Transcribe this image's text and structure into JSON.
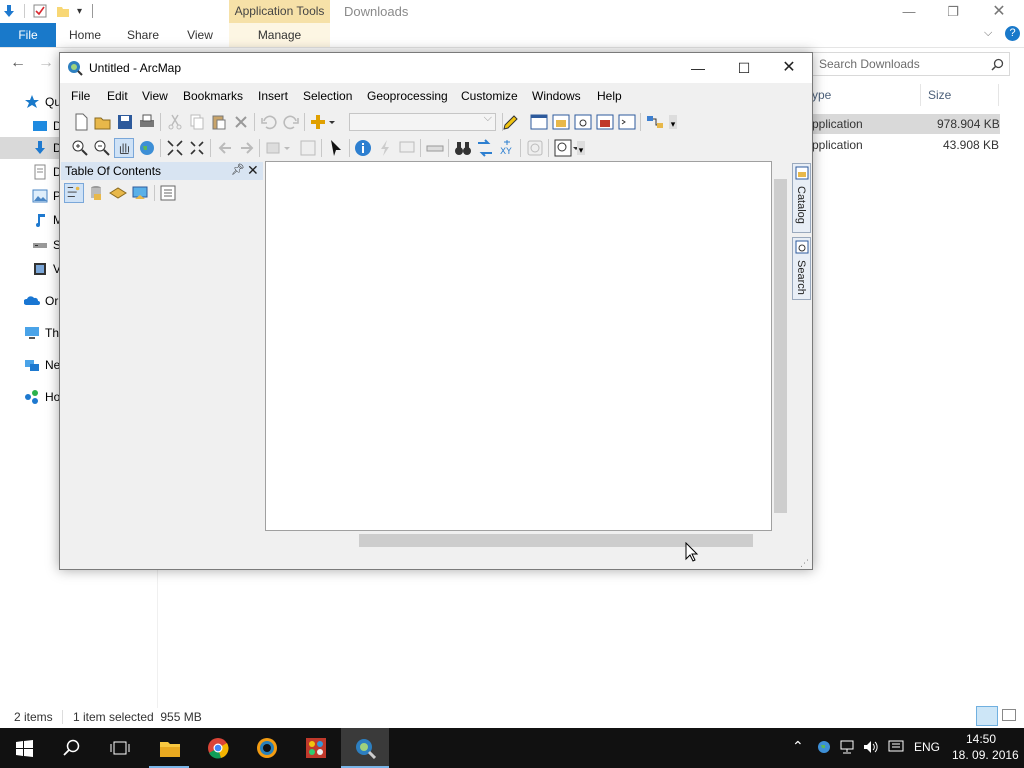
{
  "explorer": {
    "title": "Downloads",
    "context_tab_header": "Application Tools",
    "ribbon_tabs": {
      "file": "File",
      "home": "Home",
      "share": "Share",
      "view": "View",
      "manage": "Manage"
    },
    "search_placeholder": "Search Downloads",
    "columns": {
      "type": "ype",
      "size": "Size"
    },
    "files": [
      {
        "type": "pplication",
        "size": "978.904 KB",
        "selected": true
      },
      {
        "type": "pplication",
        "size": "43.908 KB",
        "selected": false
      }
    ],
    "nav_items": [
      {
        "label": "Qu",
        "icon": "star-icon"
      },
      {
        "label": "D",
        "icon": "desktop-icon"
      },
      {
        "label": "D",
        "icon": "downloads-icon"
      },
      {
        "label": "D",
        "icon": "documents-icon"
      },
      {
        "label": "P",
        "icon": "pictures-icon"
      },
      {
        "label": "M",
        "icon": "music-icon"
      },
      {
        "label": "S",
        "icon": "drive-icon"
      },
      {
        "label": "V",
        "icon": "videos-icon"
      },
      {
        "label": "Or",
        "icon": "onedrive-icon"
      },
      {
        "label": "Th",
        "icon": "this-pc-icon"
      },
      {
        "label": "Ne",
        "icon": "network-icon"
      },
      {
        "label": "Ho",
        "icon": "homegroup-icon"
      }
    ],
    "status": {
      "item_count": "2 items",
      "selection": "1 item selected  955 MB"
    }
  },
  "arcmap": {
    "title": "Untitled - ArcMap",
    "menu": [
      "File",
      "Edit",
      "View",
      "Bookmarks",
      "Insert",
      "Selection",
      "Geoprocessing",
      "Customize",
      "Windows",
      "Help"
    ],
    "toc_title": "Table Of Contents",
    "side_tabs": {
      "catalog": "Catalog",
      "search": "Search"
    }
  },
  "taskbar": {
    "language": "ENG",
    "time": "14:50",
    "date": "18. 09. 2016"
  },
  "colors": {
    "file_tab": "#1979ca",
    "context_tab": "#f6e1a8",
    "selection": "#d9d9d9",
    "toc_header": "#d8e4f2",
    "taskbar": "#111111"
  }
}
